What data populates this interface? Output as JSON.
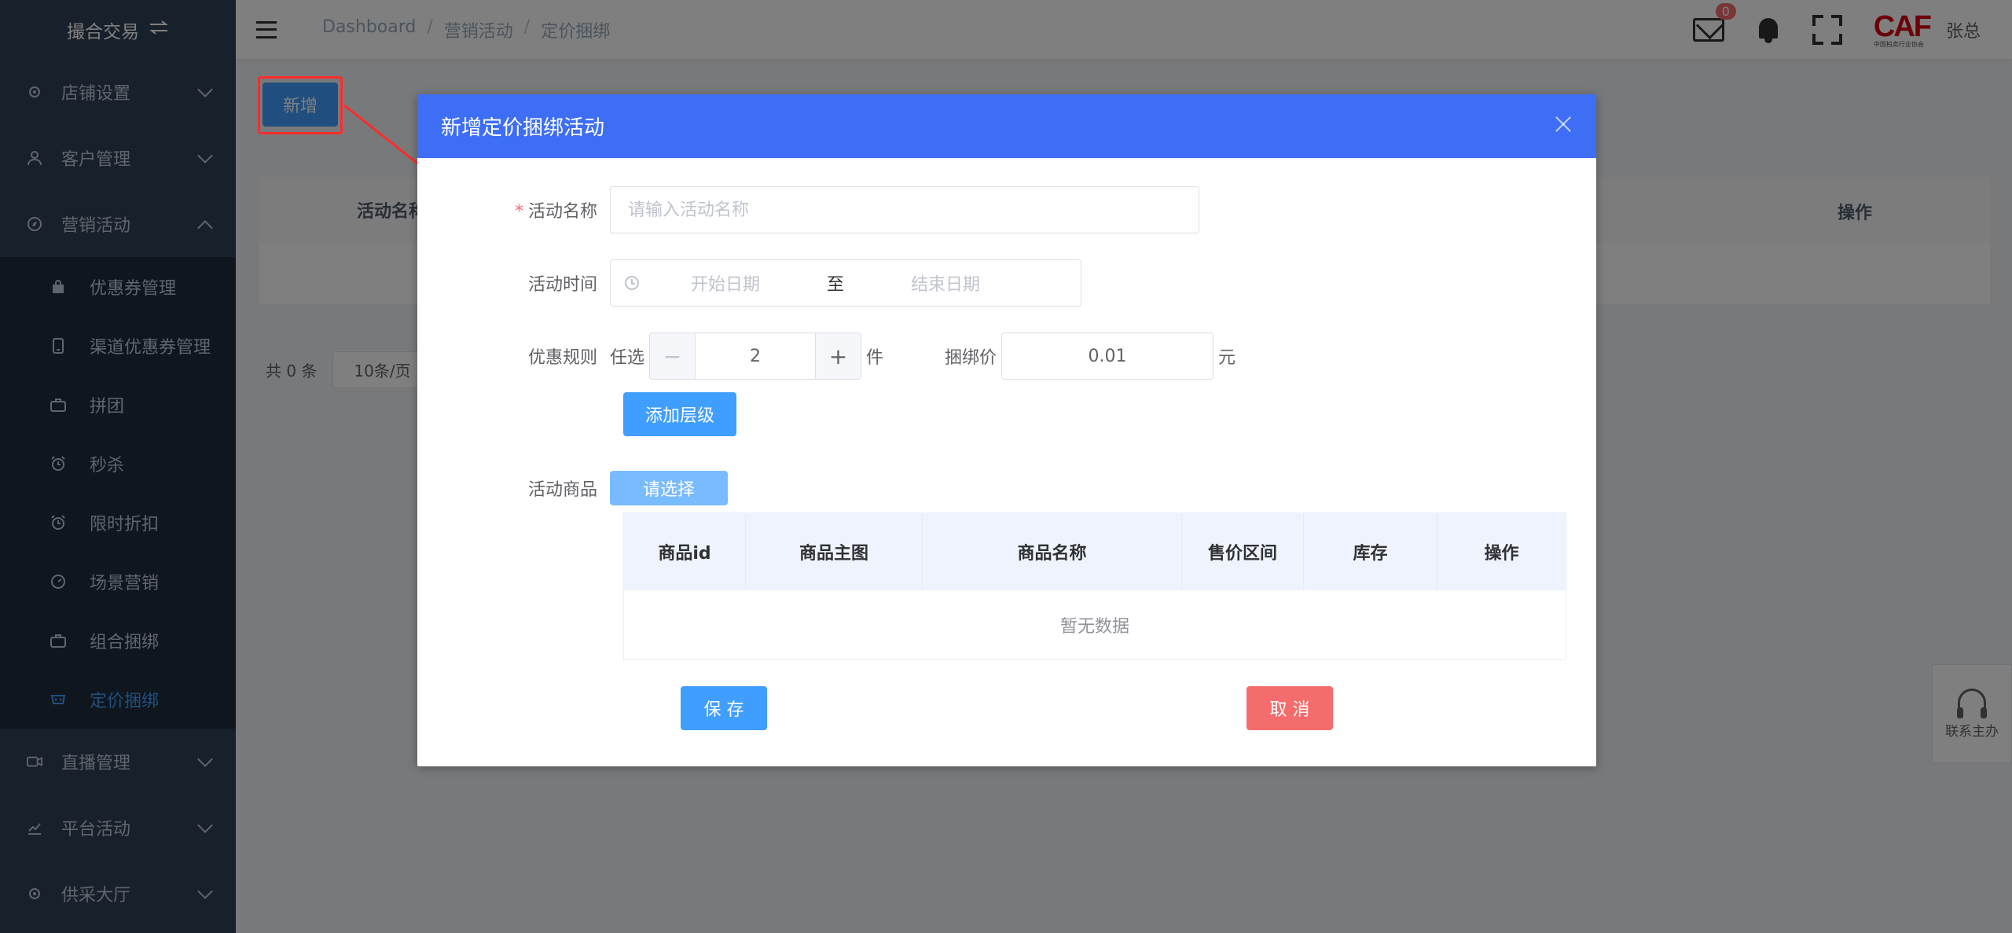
{
  "sidebar": {
    "brand": "撮合交易",
    "items": [
      {
        "label": "店铺设置"
      },
      {
        "label": "客户管理"
      },
      {
        "label": "营销活动"
      }
    ],
    "sub_items": [
      {
        "label": "优惠券管理"
      },
      {
        "label": "渠道优惠券管理"
      },
      {
        "label": "拼团"
      },
      {
        "label": "秒杀"
      },
      {
        "label": "限时折扣"
      },
      {
        "label": "场景营销"
      },
      {
        "label": "组合捆绑"
      },
      {
        "label": "定价捆绑"
      }
    ],
    "bottom_items": [
      {
        "label": "直播管理"
      },
      {
        "label": "平台活动"
      },
      {
        "label": "供采大厅"
      }
    ]
  },
  "header": {
    "breadcrumb": [
      "Dashboard",
      "营销活动",
      "定价捆绑"
    ],
    "mail_badge": "0",
    "logo_text": "CAF",
    "logo_subtext": "中国拍卖行业协会",
    "username": "张总"
  },
  "main": {
    "new_button": "新增",
    "table_col_name": "活动名称",
    "table_col_ops": "操作",
    "total": "共 0 条",
    "page_size": "10条/页",
    "contact": "联系主办"
  },
  "dialog": {
    "title": "新增定价捆绑活动",
    "name_label": "活动名称",
    "name_placeholder": "请输入活动名称",
    "time_label": "活动时间",
    "start_placeholder": "开始日期",
    "range_sep": "至",
    "end_placeholder": "结束日期",
    "rule_label": "优惠规则",
    "pick_prefix": "任选",
    "pick_count": "2",
    "pick_unit": "件",
    "bundle_label": "捆绑价",
    "bundle_price": "0.01",
    "price_unit": "元",
    "add_level": "添加层级",
    "goods_label": "活动商品",
    "choose_button": "请选择",
    "goods_columns": [
      "商品id",
      "商品主图",
      "商品名称",
      "售价区间",
      "库存",
      "操作"
    ],
    "empty_text": "暂无数据",
    "save_button": "保 存",
    "cancel_button": "取 消"
  },
  "colors": {
    "sidebar_bg": "#304156",
    "dialog_header": "#3d6ef5",
    "primary": "#409eff",
    "danger": "#f56c6c",
    "annotation": "#ff2b2b"
  }
}
